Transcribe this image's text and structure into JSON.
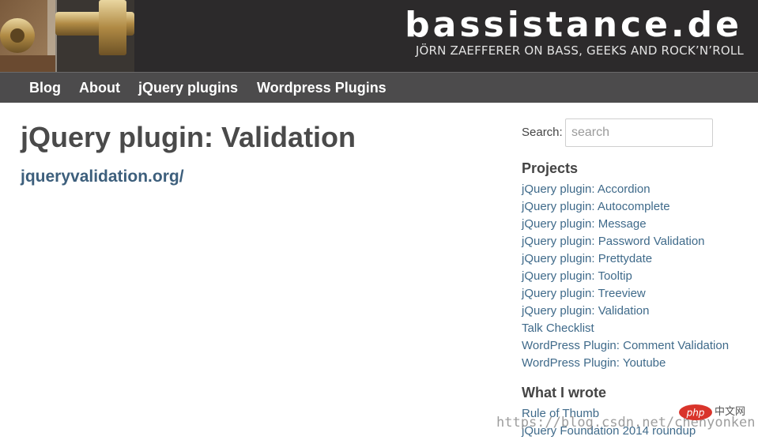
{
  "site": {
    "title": "bassistance.de",
    "tagline": "JÖRN ZAEFFERER ON BASS, GEEKS AND ROCK’N’ROLL"
  },
  "nav": {
    "items": [
      {
        "label": "Blog"
      },
      {
        "label": "About"
      },
      {
        "label": "jQuery plugins"
      },
      {
        "label": "Wordpress Plugins"
      }
    ]
  },
  "main": {
    "title": "jQuery plugin: Validation",
    "link": "jqueryvalidation.org/"
  },
  "sidebar": {
    "search": {
      "label": "Search:",
      "placeholder": "search"
    },
    "projects": {
      "heading": "Projects",
      "items": [
        "jQuery plugin: Accordion",
        "jQuery plugin: Autocomplete",
        "jQuery plugin: Message",
        "jQuery plugin: Password Validation",
        "jQuery plugin: Prettydate",
        "jQuery plugin: Tooltip",
        "jQuery plugin: Treeview",
        "jQuery plugin: Validation",
        "Talk Checklist",
        "WordPress Plugin: Comment Validation",
        "WordPress Plugin: Youtube"
      ]
    },
    "wrote": {
      "heading": "What I wrote",
      "items": [
        "Rule of Thumb",
        "jQuery Foundation 2014 roundup"
      ]
    }
  },
  "watermark": {
    "text": "https://blog.csdn.net/chenyonken",
    "logo_text": "php",
    "brand": "中文网"
  },
  "colors": {
    "header_bg": "#2c2a2b",
    "nav_bg": "#4c4b4c",
    "link": "#3f6a8a",
    "title": "#4a4a4a"
  }
}
